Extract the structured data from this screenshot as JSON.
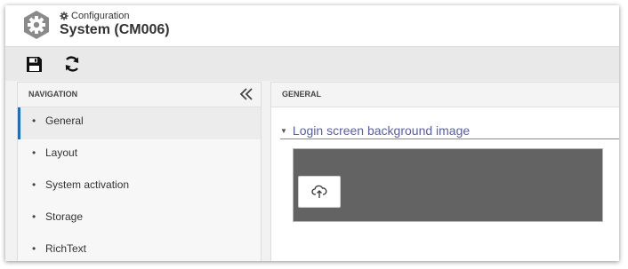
{
  "header": {
    "breadcrumb": "Configuration",
    "title": "System (CM006)"
  },
  "toolbar": {
    "save_icon": "save-icon",
    "refresh_icon": "refresh-icon"
  },
  "navigation": {
    "heading": "NAVIGATION",
    "collapse_icon": "double-chevron-left-icon",
    "items": [
      {
        "label": "General",
        "active": true
      },
      {
        "label": "Layout",
        "active": false
      },
      {
        "label": "System activation",
        "active": false
      },
      {
        "label": "Storage",
        "active": false
      },
      {
        "label": "RichText",
        "active": false
      }
    ]
  },
  "main": {
    "heading": "GENERAL",
    "section_title": "Login screen background image",
    "upload_icon": "cloud-upload-icon"
  },
  "colors": {
    "accent": "#1e6fb8",
    "link": "#5a5ea3",
    "image_placeholder": "#636363"
  }
}
